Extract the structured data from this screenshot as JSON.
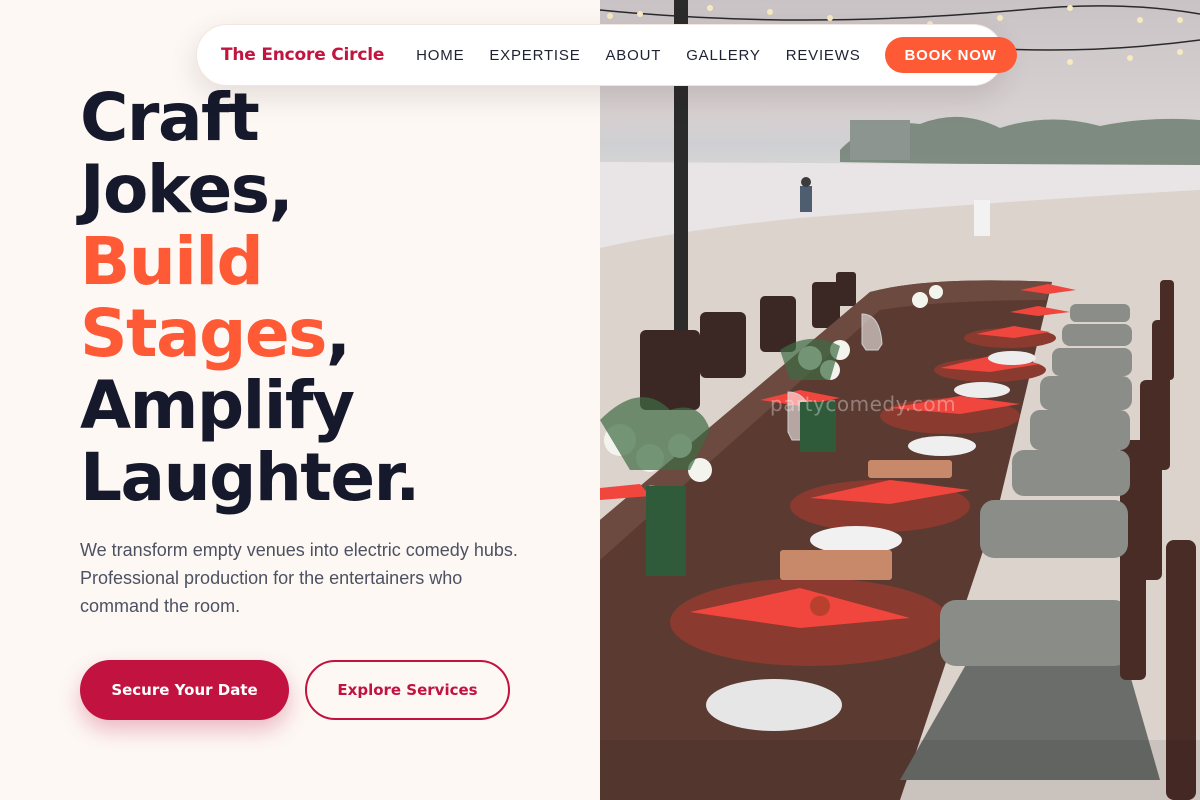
{
  "nav": {
    "brand": "The Encore Circle",
    "links": [
      {
        "label": "HOME"
      },
      {
        "label": "EXPERTISE"
      },
      {
        "label": "ABOUT"
      },
      {
        "label": "GALLERY"
      },
      {
        "label": "REVIEWS"
      }
    ],
    "cta": "BOOK NOW"
  },
  "hero": {
    "headline": {
      "line1": "Craft",
      "line2": "Jokes,",
      "line3": "Build",
      "line4_accent": "Stages",
      "line4_comma": ",",
      "line5": "Amplify",
      "line6": "Laughter."
    },
    "description": "We transform empty venues into electric comedy hubs. Professional production for the entertainers who command the room.",
    "primary_button": "Secure Your Date",
    "secondary_button": "Explore Services",
    "image_watermark": "partycomedy.com"
  },
  "colors": {
    "brand": "#c2143f",
    "accent": "#ff5a36",
    "heading": "#15192b",
    "background": "#fdf8f4"
  }
}
